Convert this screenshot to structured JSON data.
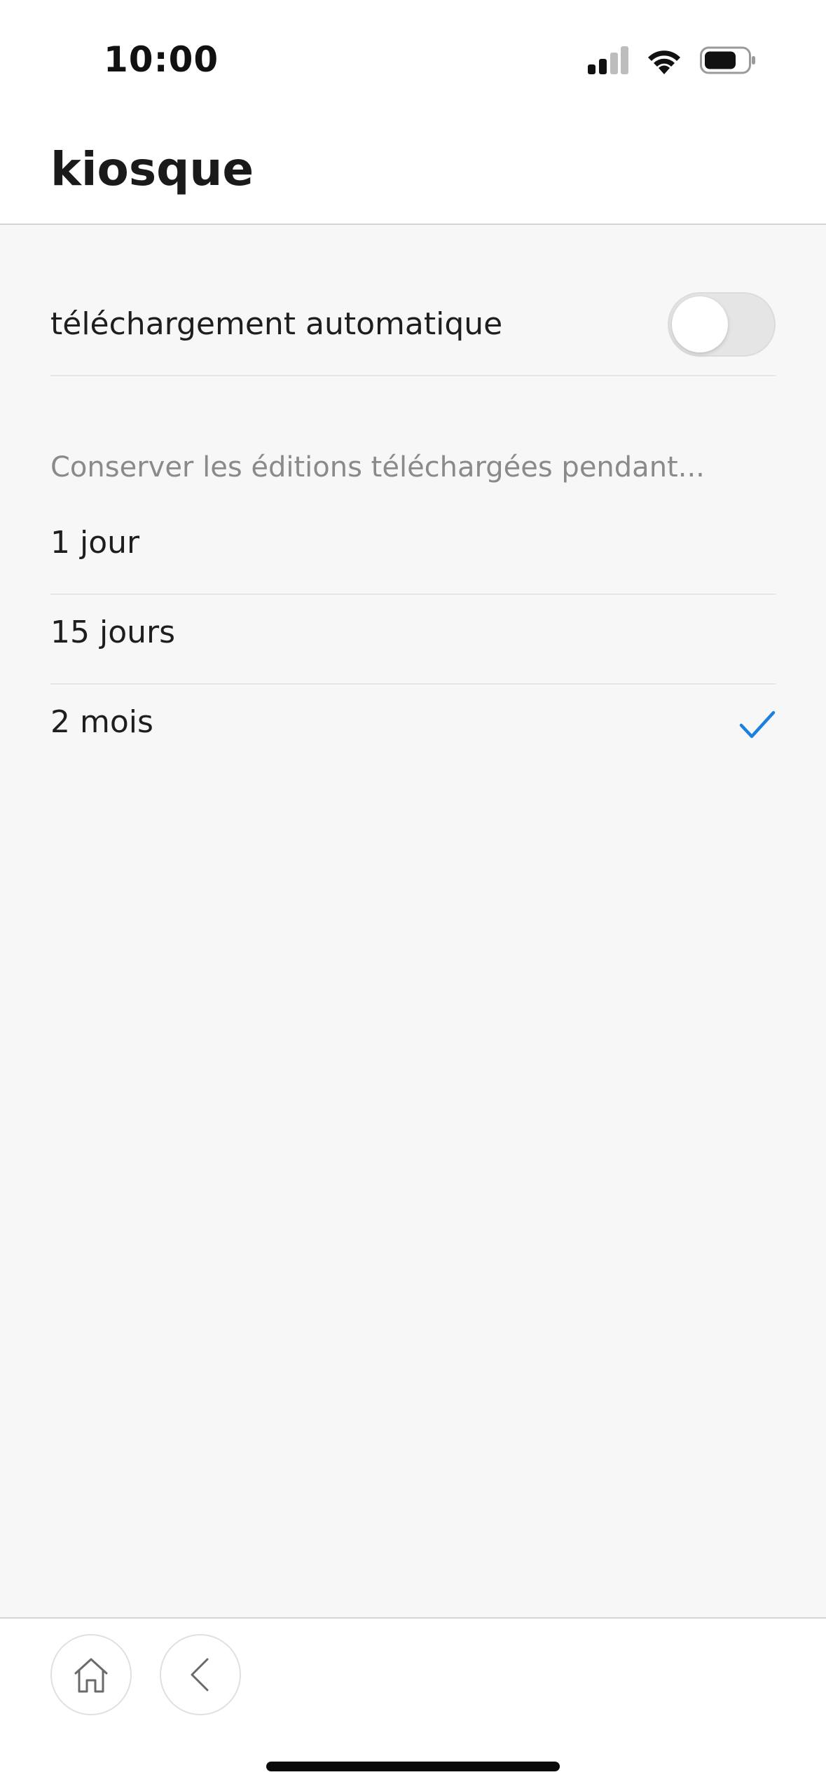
{
  "status_bar": {
    "time": "10:00"
  },
  "header": {
    "title": "kiosque"
  },
  "settings": {
    "auto_download": {
      "label": "téléchargement automatique",
      "enabled": false
    },
    "retention": {
      "section_label": "Conserver les éditions téléchargées pendant...",
      "options": [
        {
          "label": "1 jour",
          "selected": false
        },
        {
          "label": "15 jours",
          "selected": false
        },
        {
          "label": "2 mois",
          "selected": true
        }
      ]
    }
  },
  "colors": {
    "accent": "#1a7fe0",
    "background": "#f7f7f7",
    "surface": "#ffffff",
    "secondary_text": "#8a8a8a"
  },
  "icons": {
    "signal": "cellular-signal-icon",
    "wifi": "wifi-icon",
    "battery": "battery-icon",
    "check": "checkmark-icon",
    "home": "home-icon",
    "back": "chevron-left-icon"
  }
}
